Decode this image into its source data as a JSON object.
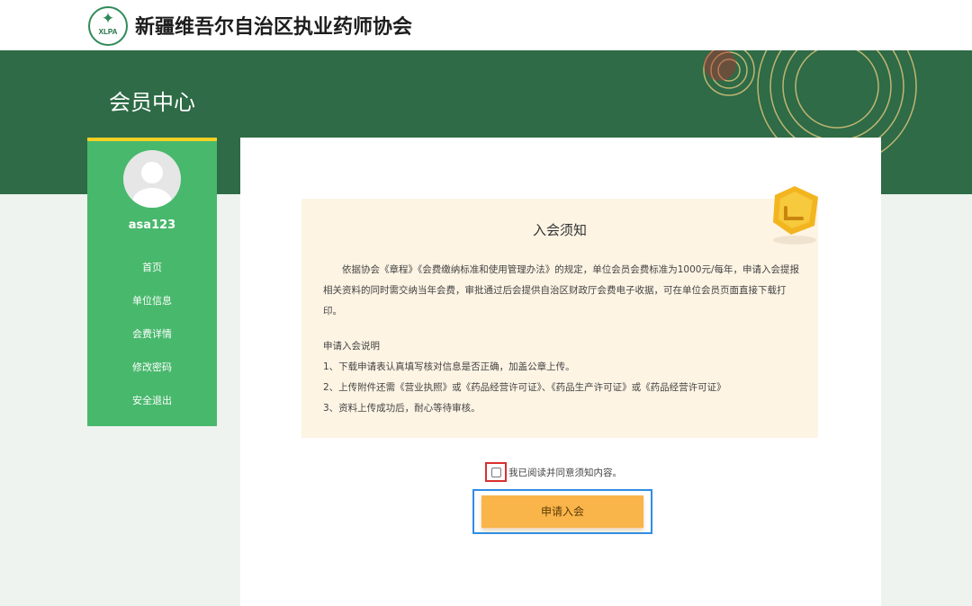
{
  "header": {
    "logo_icon": "xlpa-star-logo-icon",
    "logo_abbr": "XLPA",
    "title": "新疆维吾尔自治区执业药师协会"
  },
  "banner": {
    "title": "会员中心"
  },
  "sidebar": {
    "avatar_icon": "user-avatar-icon",
    "username": "asa123",
    "items": [
      {
        "label": "首页"
      },
      {
        "label": "单位信息"
      },
      {
        "label": "会费详情"
      },
      {
        "label": "修改密码"
      },
      {
        "label": "安全退出"
      }
    ]
  },
  "notice": {
    "title": "入会须知",
    "paragraph": "依据协会《章程》《会费缴纳标准和使用管理办法》的规定，单位会员会费标准为1000元/每年，申请入会提报相关资料的同时需交纳当年会费，审批通过后会提供自治区财政厅会费电子收据，可在单位会员页面直接下载打印。",
    "subtitle": "申请入会说明",
    "steps": [
      "1、下载申请表认真填写核对信息是否正确，加盖公章上传。",
      "2、上传附件还需《营业执照》或《药品经营许可证》、《药品生产许可证》或《药品经营许可证》",
      "3、资料上传成功后，耐心等待审核。"
    ]
  },
  "agree": {
    "checked": false,
    "label": "我已阅读并同意须知内容。"
  },
  "apply_button": {
    "label": "申请入会"
  },
  "colors": {
    "brand_green": "#2e6b46",
    "sidebar_green": "#48b86c",
    "sidebar_accent": "#f2d024",
    "notice_bg": "#fdf4e4",
    "button_orange": "#f9b54a",
    "highlight_red": "#d93030",
    "highlight_blue": "#2f8de4"
  }
}
